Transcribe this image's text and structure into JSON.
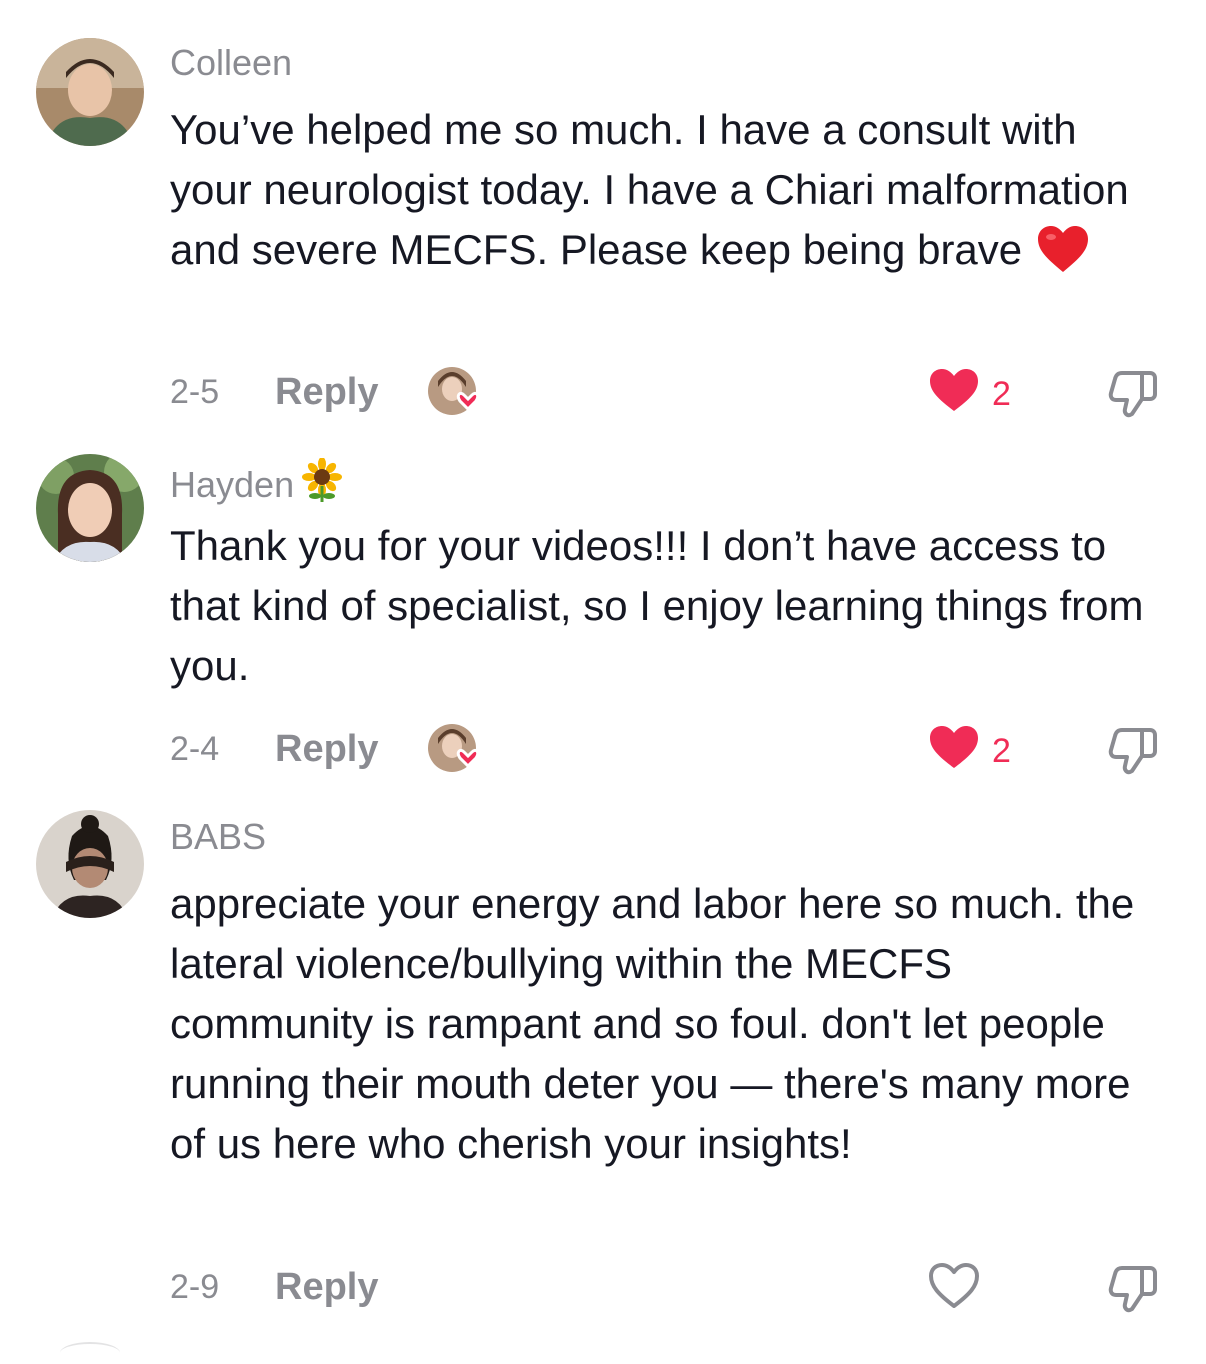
{
  "comments": [
    {
      "username": "Colleen",
      "text": "You’ve helped me so much. I have a consult with your neurologist today. I have a Chiari malformation and severe MECFS. Please keep being brave",
      "date": "2-5",
      "reply_label": "Reply",
      "likes": "2",
      "liked": true,
      "creator_liked": true,
      "trailing_emoji": "heart-emoji"
    },
    {
      "username": "Hayden",
      "username_emoji": "sunflower-emoji",
      "text": "Thank you for your videos!!! I don’t have access to that kind of specialist, so I enjoy learning things from you.",
      "date": "2-4",
      "reply_label": "Reply",
      "likes": "2",
      "liked": true,
      "creator_liked": true
    },
    {
      "username": "BABS",
      "text": "appreciate your energy and labor here so much. the lateral violence/bullying within the MECFS community is rampant and so foul. don't let people running their mouth deter you — there's many more of us here who cherish your insights!",
      "date": "2-9",
      "reply_label": "Reply",
      "liked": false,
      "creator_liked": false
    }
  ],
  "colors": {
    "like_red": "#f02c56",
    "muted_gray": "#8a8b91",
    "text": "#161823"
  }
}
